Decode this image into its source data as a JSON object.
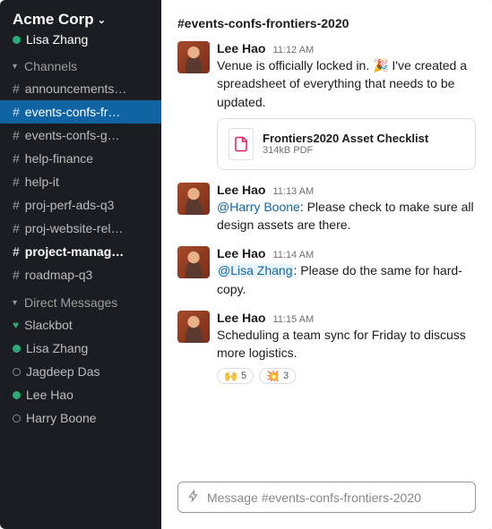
{
  "workspace": {
    "name": "Acme Corp",
    "user": "Lisa Zhang"
  },
  "sidebar": {
    "channels_label": "Channels",
    "dms_label": "Direct Messages",
    "channels": [
      {
        "label": "announcements…",
        "selected": false,
        "bold": false
      },
      {
        "label": "events-confs-fr…",
        "selected": true,
        "bold": false
      },
      {
        "label": "events-confs-g…",
        "selected": false,
        "bold": false
      },
      {
        "label": "help-finance",
        "selected": false,
        "bold": false
      },
      {
        "label": "help-it",
        "selected": false,
        "bold": false
      },
      {
        "label": "proj-perf-ads-q3",
        "selected": false,
        "bold": false
      },
      {
        "label": "proj-website-rel…",
        "selected": false,
        "bold": false
      },
      {
        "label": "project-manag…",
        "selected": false,
        "bold": true
      },
      {
        "label": "roadmap-q3",
        "selected": false,
        "bold": false
      }
    ],
    "dms": [
      {
        "label": "Slackbot",
        "presence": "heart"
      },
      {
        "label": "Lisa Zhang",
        "presence": "online"
      },
      {
        "label": "Jagdeep Das",
        "presence": "away"
      },
      {
        "label": "Lee Hao",
        "presence": "online"
      },
      {
        "label": "Harry Boone",
        "presence": "away"
      }
    ]
  },
  "channel": {
    "name": "#events-confs-frontiers-2020"
  },
  "messages": [
    {
      "author": "Lee Hao",
      "time": "11:12 AM",
      "text_pre": "Venue is officially locked in. ",
      "emoji": "🎉",
      "text_post": " I've created a spreadsheet of everything that needs to be updated.",
      "attachment": {
        "title": "Frontiers2020 Asset Checklist",
        "meta": "314kB PDF"
      }
    },
    {
      "author": "Lee Hao",
      "time": "11:13 AM",
      "mention": "@Harry Boone",
      "mention_style": "plain",
      "text_after": ": Please check to make sure all design assets are there."
    },
    {
      "author": "Lee Hao",
      "time": "11:14 AM",
      "mention": "@Lisa Zhang",
      "mention_style": "bg",
      "text_after": ": Please do the same for hard-copy."
    },
    {
      "author": "Lee Hao",
      "time": "11:15 AM",
      "text": "Scheduling a team sync for Friday to discuss more logistics.",
      "reactions": [
        {
          "emoji": "🙌",
          "count": "5"
        },
        {
          "emoji": "💥",
          "count": "3"
        }
      ]
    }
  ],
  "composer": {
    "placeholder": "Message #events-confs-frontiers-2020"
  }
}
